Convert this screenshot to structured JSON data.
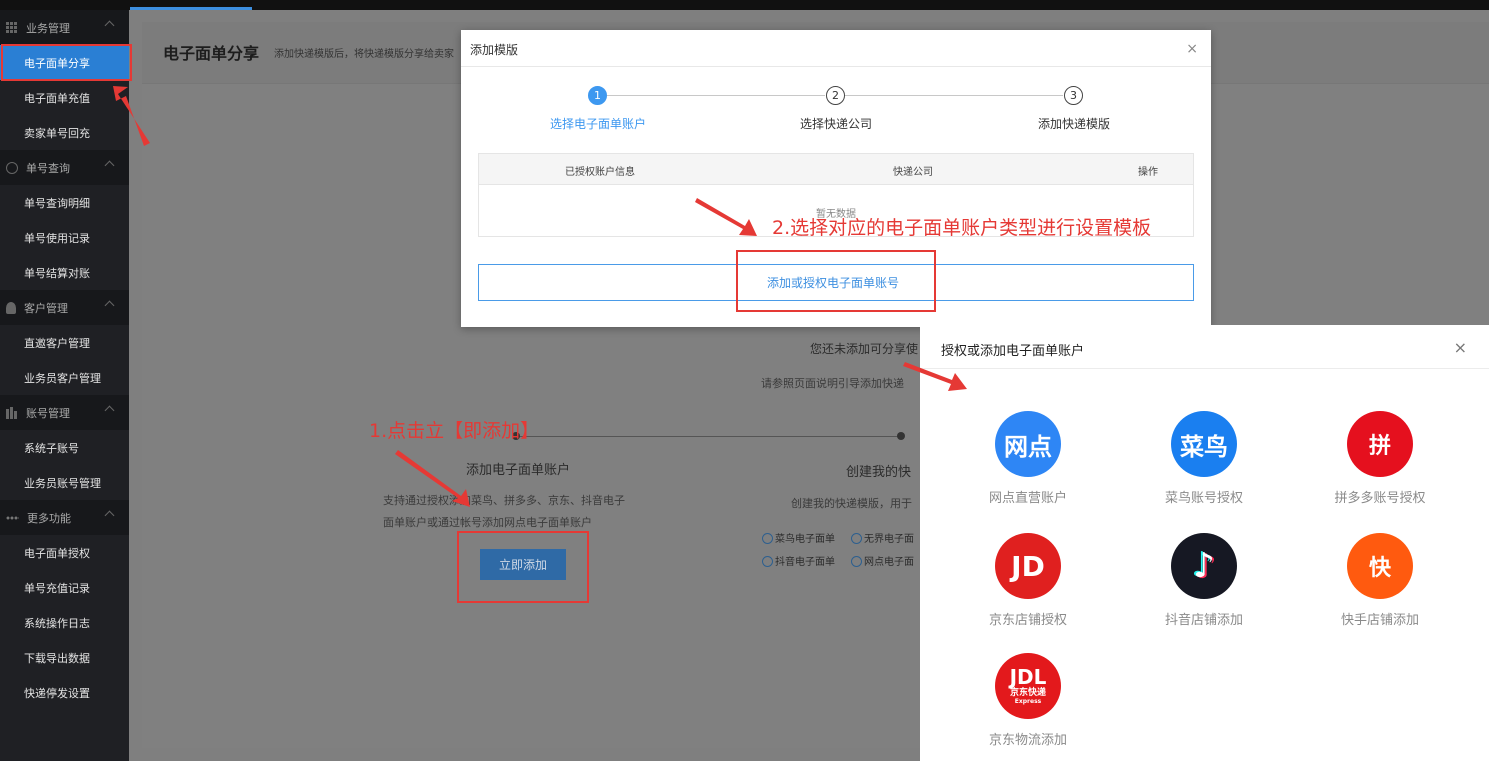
{
  "sidebar": {
    "groups": [
      {
        "label": "业务管理",
        "icon": "grid-icon",
        "items": [
          "电子面单分享",
          "电子面单充值",
          "卖家单号回充"
        ]
      },
      {
        "label": "单号查询",
        "icon": "search-icon",
        "items": [
          "单号查询明细",
          "单号使用记录",
          "单号结算对账"
        ]
      },
      {
        "label": "客户管理",
        "icon": "user-icon",
        "items": [
          "直邀客户管理",
          "业务员客户管理"
        ]
      },
      {
        "label": "账号管理",
        "icon": "bar-chart-icon",
        "items": [
          "系统子账号",
          "业务员账号管理"
        ]
      },
      {
        "label": "更多功能",
        "icon": "more-dots-icon",
        "items": [
          "电子面单授权",
          "单号充值记录",
          "系统操作日志",
          "下载导出数据",
          "快递停发设置"
        ]
      }
    ],
    "active_item": "电子面单分享"
  },
  "page": {
    "title": "电子面单分享",
    "desc": "添加快递模版后，将快递模版分享给卖家",
    "empty_notice": "您还未添加可分享使",
    "empty_hint": "请参照页面说明引导添加快递",
    "step1_title": "添加电子面单账户",
    "step1_desc_1": "支持通过授权添加菜鸟、拼多多、京东、抖音电子",
    "step1_desc_2": "面单账户或通过帐号添加网点电子面单账户",
    "step1_button": "立即添加",
    "step2_title": "创建我的快",
    "step2_desc": "创建我的快递模版，用于",
    "tags": [
      "菜鸟电子面单",
      "无界电子面",
      "抖音电子面单",
      "网点电子面"
    ]
  },
  "modal_add_template": {
    "title": "添加模版",
    "close": "×",
    "steps": [
      {
        "num": "1",
        "label": "选择电子面单账户"
      },
      {
        "num": "2",
        "label": "选择快递公司"
      },
      {
        "num": "3",
        "label": "添加快递模版"
      }
    ],
    "table_headers": [
      "已授权账户信息",
      "快递公司",
      "操作"
    ],
    "empty_text": "暂无数据",
    "add_button": "添加或授权电子面单账号"
  },
  "modal_authorize": {
    "title": "授权或添加电子面单账户",
    "close": "×",
    "options": [
      {
        "logo_text": "网点",
        "label": "网点直营账户",
        "color": "#2e86f5",
        "icon": "wangdian-logo-icon"
      },
      {
        "logo_text": "菜鸟",
        "label": "菜鸟账号授权",
        "color": "#1a7ff0",
        "icon": "cainiao-logo-icon"
      },
      {
        "logo_text": "拼",
        "label": "拼多多账号授权",
        "color": "#e5101e",
        "icon": "pinduoduo-logo-icon"
      },
      {
        "logo_text": "JD",
        "label": "京东店铺授权",
        "color": "#e0201f",
        "icon": "jd-logo-icon"
      },
      {
        "logo_text": "♪",
        "label": "抖音店铺添加",
        "color": "#161823",
        "icon": "douyin-logo-icon"
      },
      {
        "logo_text": "快",
        "label": "快手店铺添加",
        "color": "#ff5a0f",
        "icon": "kuaishou-logo-icon"
      },
      {
        "logo_text": "JDL",
        "logo_sub": "京东快递",
        "logo_sub2": "Express",
        "label": "京东物流添加",
        "color": "#e3191c",
        "icon": "jdl-logo-icon"
      }
    ]
  },
  "annotations": {
    "note1": "1.点击立【即添加】",
    "note2": "2.选择对应的电子面单账户类型进行设置模板"
  }
}
